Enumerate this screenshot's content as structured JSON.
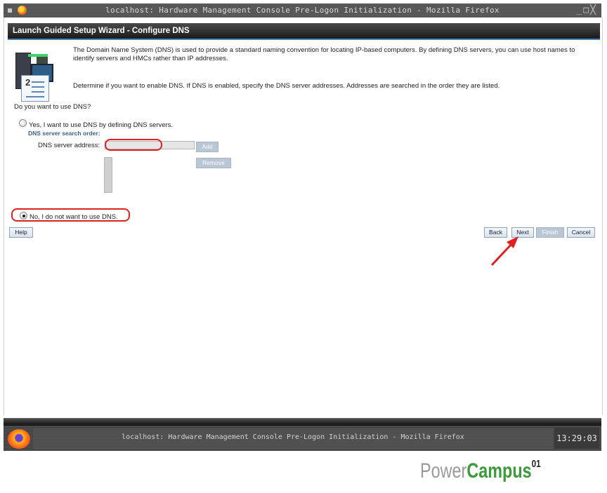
{
  "window": {
    "title": "localhost: Hardware Management Console Pre-Logon Initialization - Mozilla Firefox",
    "controls": "_□╳"
  },
  "wizard": {
    "header": "Launch Guided Setup Wizard - Configure DNS",
    "description1": "The Domain Name System (DNS) is used to provide a standard naming convention for locating IP-based computers. By defining DNS servers, you can use host names to identify servers and HMCs rather than IP addresses.",
    "description2": "Determine if you want to enable DNS. If DNS is enabled, specify the DNS server addresses. Addresses are searched in the order they are listed.",
    "question": "Do you want to use DNS?",
    "illustration_number": "2",
    "yes_option": "Yes, I want to use DNS by defining DNS servers.",
    "search_order_label": "DNS server search order:",
    "address_label": "DNS server address:",
    "address_value": "",
    "add_label": "Add",
    "remove_label": "Remove",
    "no_option": "No, I do not want to use DNS.",
    "selected_option": "no"
  },
  "footer_buttons": {
    "help": "Help",
    "back": "Back",
    "next": "Next",
    "finish": "Finish",
    "cancel": "Cancel"
  },
  "taskbar": {
    "task_title": "localhost: Hardware Management Console Pre-Logon Initialization - Mozilla Firefox",
    "clock": "13:29:03"
  },
  "watermark": {
    "part1": "Power",
    "part2": "Campus",
    "sup": "01"
  },
  "colors": {
    "annotation": "#e02020",
    "header_bg": "#222222",
    "accent_blue": "#4b7fb3",
    "brand_green": "#3c9a3c"
  }
}
